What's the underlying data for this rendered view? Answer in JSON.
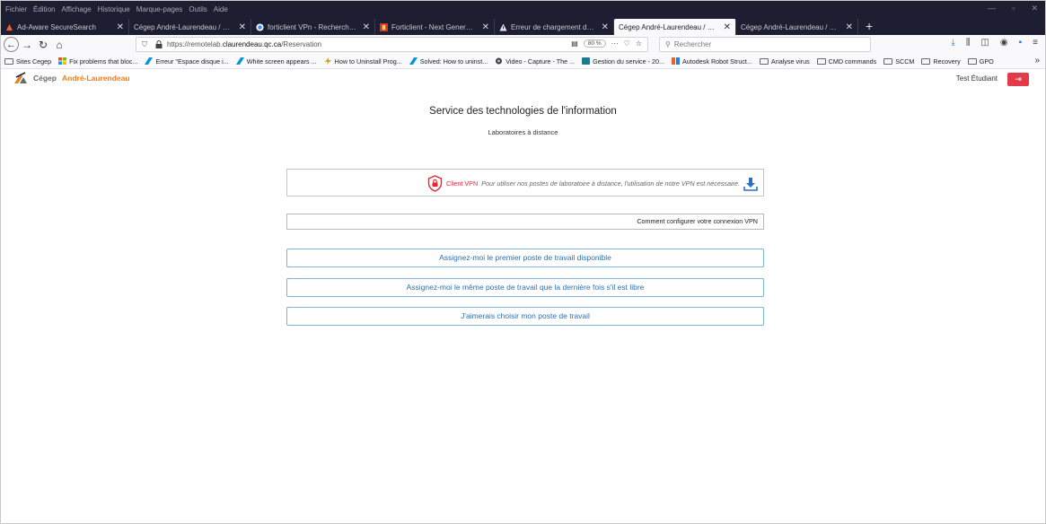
{
  "browser": {
    "menu": [
      "Fichier",
      "Édition",
      "Affichage",
      "Historique",
      "Marque-pages",
      "Outils",
      "Aide"
    ],
    "tabs": [
      {
        "label": "Ad-Aware SecureSearch",
        "icon": "adaware-icon",
        "color": "#e8622c",
        "active": false
      },
      {
        "label": "Cégep André-Laurendeau / Labora",
        "icon": "none",
        "color": "",
        "active": false
      },
      {
        "label": "forticlient VPn - Recherche Go",
        "icon": "google-icon",
        "color": "#4285f4",
        "active": false
      },
      {
        "label": "Forticlient - Next Generation En",
        "icon": "fortinet-icon",
        "color": "#da3030",
        "active": false
      },
      {
        "label": "Erreur de chargement de la pag",
        "icon": "warning-icon",
        "color": "#e8e8e8",
        "active": false
      },
      {
        "label": "Cégep André-Laurendeau / Labora",
        "icon": "none",
        "color": "",
        "active": true
      },
      {
        "label": "Cégep André-Laurendeau / Labora",
        "icon": "none",
        "color": "",
        "active": false
      }
    ],
    "url": {
      "prefix": "https://remotelab.",
      "domain": "claurendeau.qc.ca",
      "path": "/Reservation"
    },
    "zoom": "80 %",
    "search_placeholder": "Rechercher",
    "bookmarks": [
      {
        "label": "Sites Cegep",
        "icon": "folder-icon"
      },
      {
        "label": "Fix problems that bloc...",
        "icon": "windows-icon"
      },
      {
        "label": "Erreur \"Espace disque i...",
        "icon": "autodesk-icon"
      },
      {
        "label": "White screen appears ...",
        "icon": "autodesk-icon"
      },
      {
        "label": "How to Uninstall Prog...",
        "icon": "bolt-icon"
      },
      {
        "label": "Solved: How to uninst...",
        "icon": "autodesk-icon"
      },
      {
        "label": "Video - Capture - The ...",
        "icon": "capture-icon"
      },
      {
        "label": "Gestion du service - 20...",
        "icon": "service-icon"
      },
      {
        "label": "Autodesk Robot Struct...",
        "icon": "autodesk-robot-icon"
      },
      {
        "label": "Analyse virus",
        "icon": "folder-icon"
      },
      {
        "label": "CMD commands",
        "icon": "folder-icon"
      },
      {
        "label": "SCCM",
        "icon": "folder-icon"
      },
      {
        "label": "Recovery",
        "icon": "folder-icon"
      },
      {
        "label": "GPO",
        "icon": "folder-icon"
      }
    ]
  },
  "site": {
    "logo_part1": "Cégep",
    "logo_part2": "André-Laurendeau",
    "user": "Test Étudiant"
  },
  "main": {
    "title": "Service des technologies de l'information",
    "subtitle": "Laboratoires à distance",
    "vpn_label": "Client VPN",
    "vpn_desc": "Pour utiliser nos postes de laboratoire à distance, l'utilisation de notre VPN est nécessaire.",
    "howto": "Comment configurer votre connexion VPN",
    "buttons": [
      "Assignez-moi le premier poste de travail disponible",
      "Assignez-moi le même poste de travail que la dernière fois s'il est libre",
      "J'aimerais choisir mon poste de travail"
    ]
  },
  "colors": {
    "accent_orange": "#ee7d22",
    "danger_red": "#e33a49",
    "button_blue": "#2d6fb3"
  }
}
